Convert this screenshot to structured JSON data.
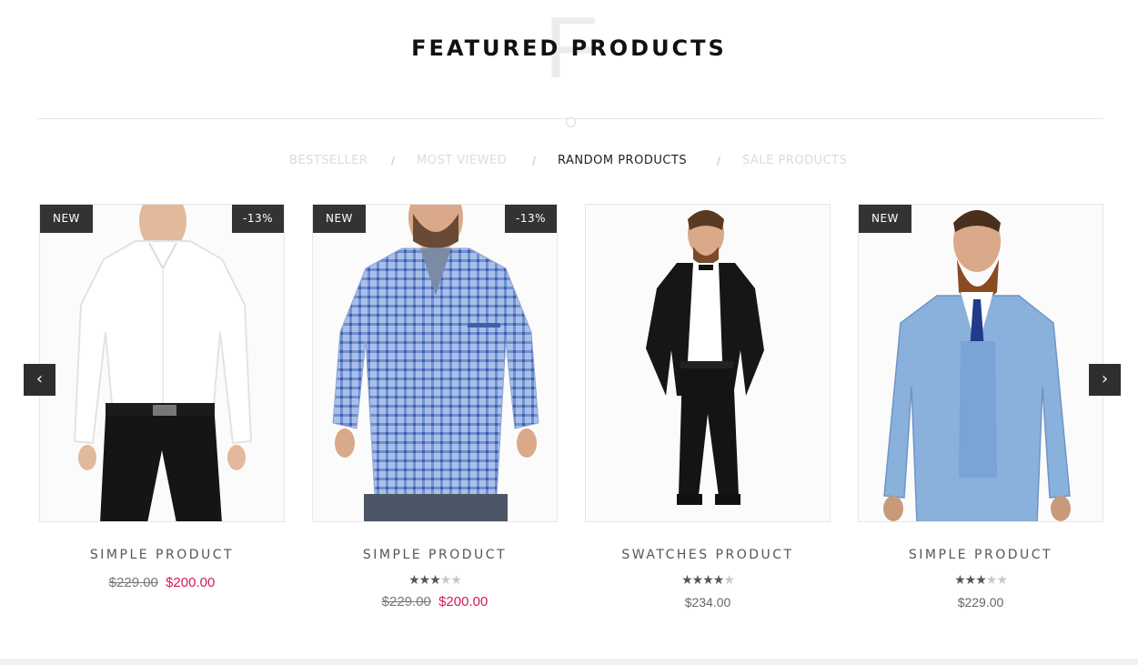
{
  "section": {
    "title": "FEATURED PRODUCTS",
    "watermark_letter": "F"
  },
  "tabs": [
    {
      "label": "BESTSELLER",
      "active": false
    },
    {
      "label": "MOST VIEWED",
      "active": false
    },
    {
      "label": "RANDOM PRODUCTS",
      "active": true
    },
    {
      "label": "SALE PRODUCTS",
      "active": false
    }
  ],
  "tab_separator": "/",
  "products": [
    {
      "name": "SIMPLE PRODUCT",
      "badge_new": "NEW",
      "badge_sale": "-13%",
      "rating": 0,
      "old_price": "$229.00",
      "price": "$200.00"
    },
    {
      "name": "SIMPLE PRODUCT",
      "badge_new": "NEW",
      "badge_sale": "-13%",
      "rating": 3,
      "old_price": "$229.00",
      "price": "$200.00"
    },
    {
      "name": "SWATCHES PRODUCT",
      "badge_new": "",
      "badge_sale": "",
      "rating": 4,
      "old_price": "",
      "price": "$234.00"
    },
    {
      "name": "SIMPLE PRODUCT",
      "badge_new": "NEW",
      "badge_sale": "",
      "rating": 3,
      "old_price": "",
      "price": "$229.00"
    }
  ],
  "carousel": {
    "prev_icon": "chevron-left-icon",
    "next_icon": "chevron-right-icon",
    "prev_glyph": "‹",
    "next_glyph": "›"
  },
  "colors": {
    "sale_price": "#d11b5a",
    "badge_bg": "#333333",
    "accent_dark": "#2e2e2e"
  }
}
